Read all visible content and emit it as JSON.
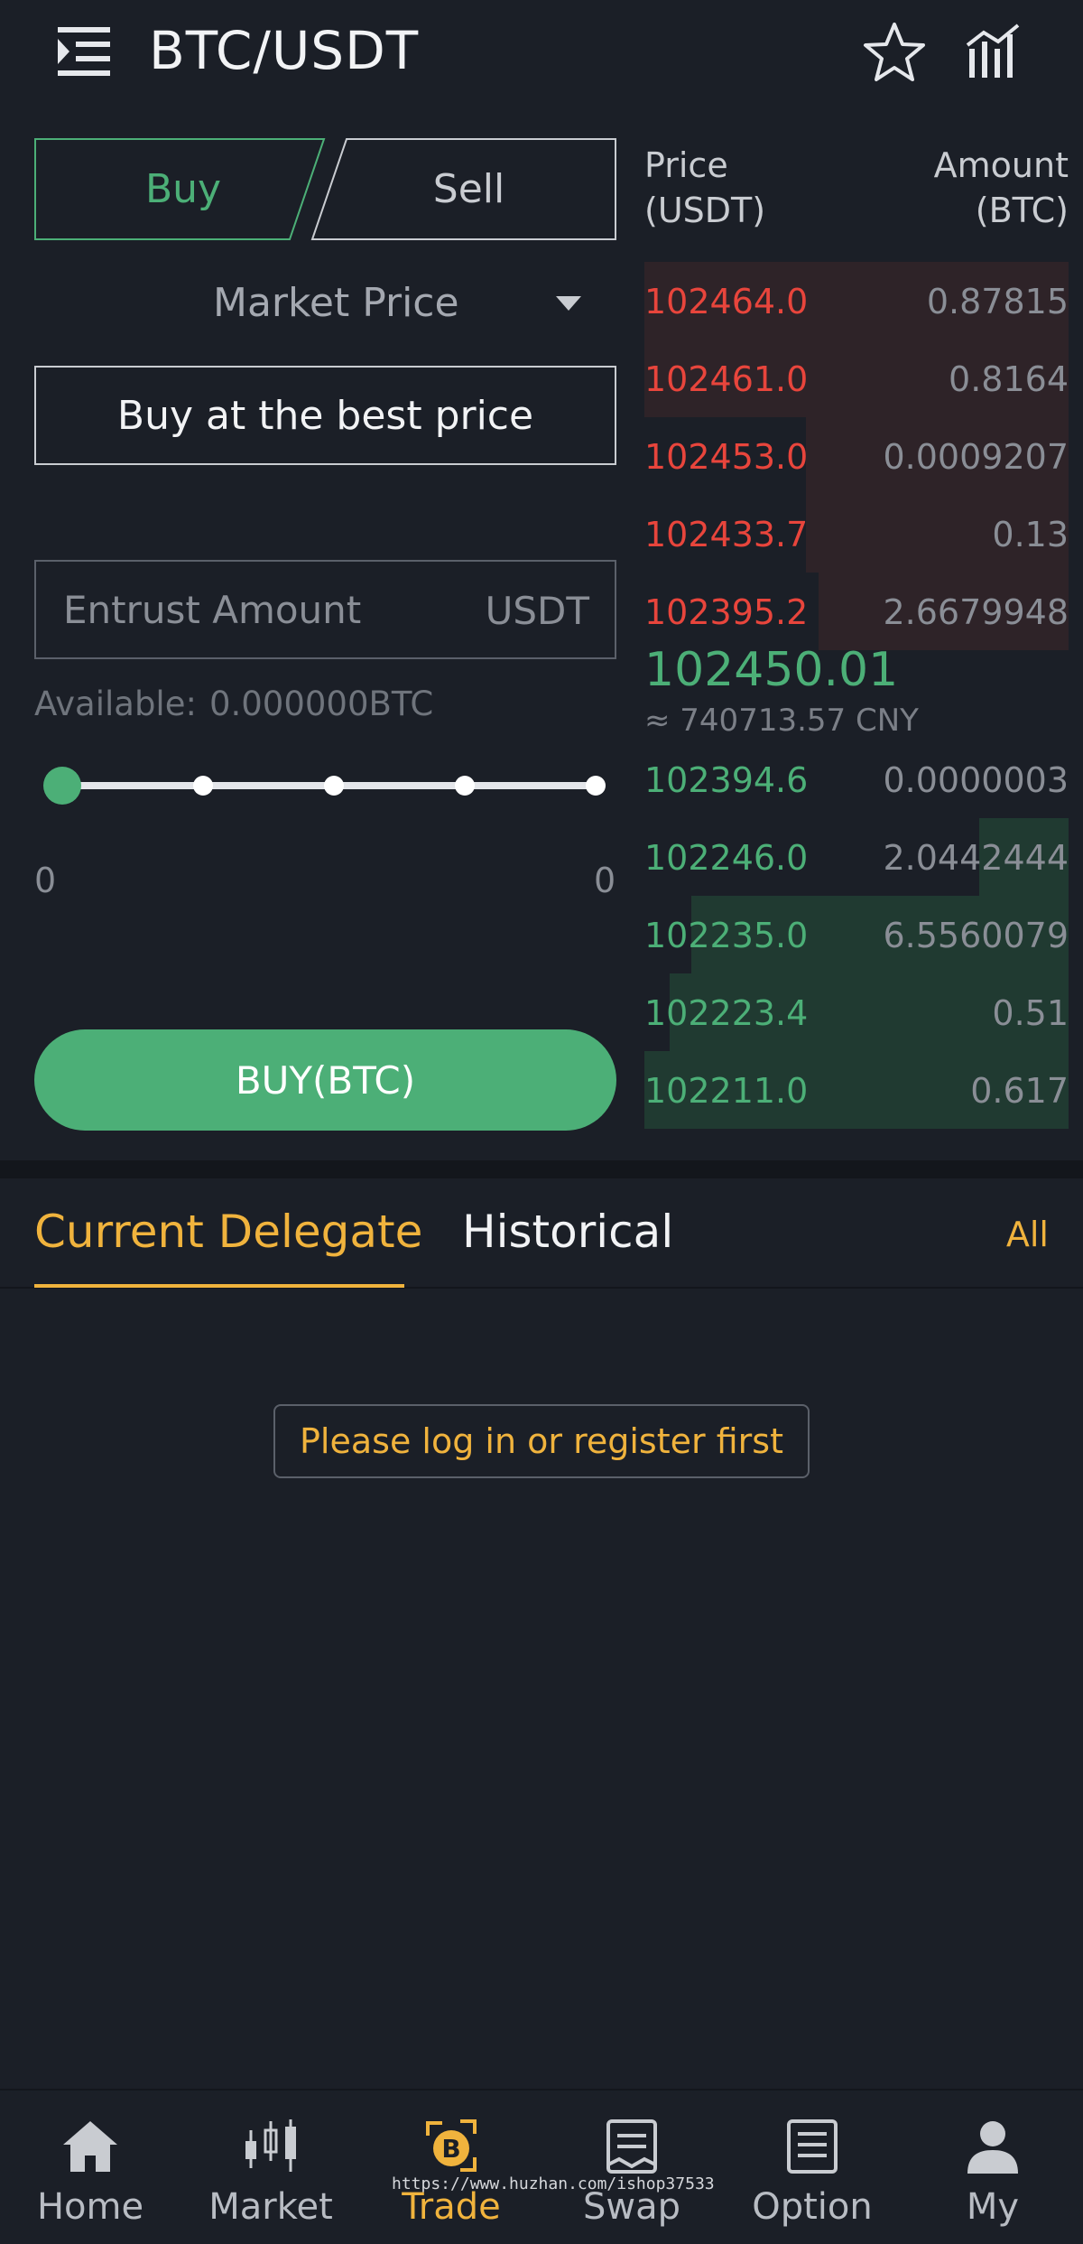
{
  "header": {
    "title": "BTC/USDT",
    "icons": [
      "menu-icon",
      "star-icon",
      "chart-bars-icon"
    ]
  },
  "trade_form": {
    "tab_buy": "Buy",
    "tab_sell": "Sell",
    "order_type": "Market Price",
    "best_price_label": "Buy at the best price",
    "amount_placeholder": "Entrust Amount",
    "amount_unit": "USDT",
    "available_label": "Available:",
    "available_value": "0.000000BTC",
    "slider_position": 0,
    "range_min": "0",
    "range_max": "0",
    "submit_label": "BUY(BTC)"
  },
  "order_book": {
    "price_header_1": "Price",
    "price_header_2": "(USDT)",
    "amount_header_1": "Amount",
    "amount_header_2": "(BTC)",
    "asks": [
      {
        "price": "102464.0",
        "amount": "0.87815",
        "depth": 1.0
      },
      {
        "price": "102461.0",
        "amount": "0.8164",
        "depth": 1.0
      },
      {
        "price": "102453.0",
        "amount": "0.0009207",
        "depth": 0.62
      },
      {
        "price": "102433.7",
        "amount": "0.13",
        "depth": 0.62
      },
      {
        "price": "102395.2",
        "amount": "2.6679948",
        "depth": 0.59
      }
    ],
    "last_price": "102450.01",
    "last_price_cny": "≈ 740713.57 CNY",
    "bids": [
      {
        "price": "102394.6",
        "amount": "0.0000003",
        "depth": 0.0
      },
      {
        "price": "102246.0",
        "amount": "2.0442444",
        "depth": 0.21
      },
      {
        "price": "102235.0",
        "amount": "6.5560079",
        "depth": 0.89
      },
      {
        "price": "102223.4",
        "amount": "0.51",
        "depth": 0.94
      },
      {
        "price": "102211.0",
        "amount": "0.617",
        "depth": 1.0
      }
    ],
    "colors": {
      "ask": "#e8453c",
      "bid": "#4caf77"
    }
  },
  "orders": {
    "tab_current": "Current Delegate",
    "tab_historical": "Historical",
    "all_link": "All",
    "login_prompt": "Please log in or register first"
  },
  "bottom_nav": {
    "items": [
      {
        "label": "Home",
        "icon": "home-icon"
      },
      {
        "label": "Market",
        "icon": "candlestick-icon"
      },
      {
        "label": "Trade",
        "icon": "bitcoin-exchange-icon",
        "active": true
      },
      {
        "label": "Swap",
        "icon": "document-icon"
      },
      {
        "label": "Option",
        "icon": "document-list-icon"
      },
      {
        "label": "My",
        "icon": "user-icon"
      }
    ],
    "accent_color": "#f0b33d"
  },
  "watermark": "https://www.huzhan.com/ishop37533"
}
